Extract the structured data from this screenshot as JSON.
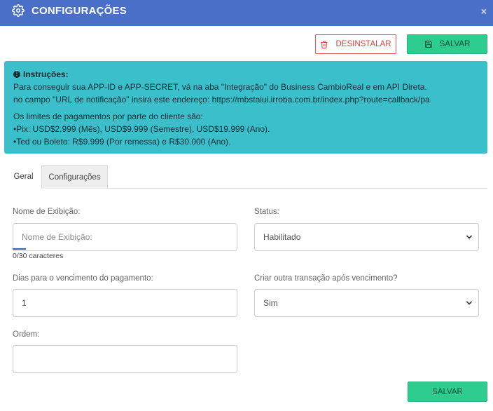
{
  "header": {
    "title": "CONFIGURAÇÕES",
    "close_label": "×"
  },
  "toolbar": {
    "uninstall_label": "DESINSTALAR",
    "save_label": "SALVAR"
  },
  "alert": {
    "heading": "Instruções:",
    "line1": "Para conseguir sua APP-ID e APP-SECRET, vá na aba \"Integração\" do Business CambioReal e em API Direta.",
    "line2": "no campo \"URL de notificação\" insira este endereço:  https://mbstaiui.irroba.com.br/index.php?route=callback/pa",
    "line3": "Os limites de pagamentos por parte do cliente são:",
    "line4": "•Pix: USD$2.999 (Mês), USD$9.999 (Semestre), USD$19.999 (Ano).",
    "line5": "•Ted ou Boleto: R$9.999 (Por remessa) e R$30.000 (Ano)."
  },
  "tabs": [
    {
      "label": "Geral"
    },
    {
      "label": "Configurações"
    }
  ],
  "form": {
    "display_name": {
      "label": "Nome de Exibição:",
      "placeholder": "Nome de Exibição:",
      "value": "",
      "counter": "0/30 caracteres"
    },
    "status": {
      "label": "Status:",
      "value": "Habilitado"
    },
    "due_days": {
      "label": "Dias para o vencimento do pagamento:",
      "value": "1"
    },
    "new_transaction": {
      "label": "Criar outra transação após vencimento?",
      "value": "Sim"
    },
    "order": {
      "label": "Ordem:",
      "value": ""
    }
  },
  "footer": {
    "save_label": "SALVAR"
  },
  "colors": {
    "header_bg": "#4a6fc9",
    "alert_bg": "#3bbfcb",
    "success": "#2ecc8f",
    "danger": "#e45353"
  }
}
